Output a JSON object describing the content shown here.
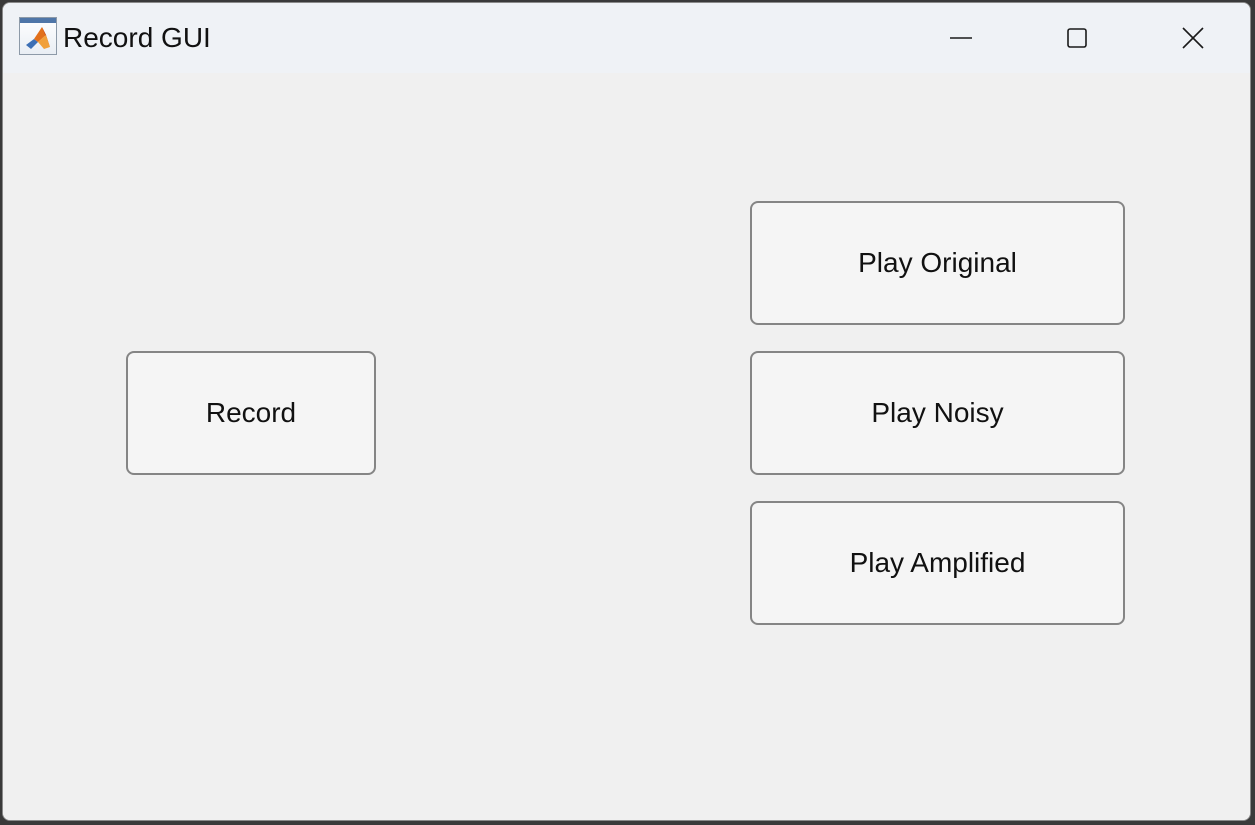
{
  "window": {
    "title": "Record GUI",
    "controls": {
      "minimize_icon": "minimize-icon",
      "maximize_icon": "maximize-icon",
      "close_icon": "close-icon"
    },
    "app_icon": "matlab-icon"
  },
  "buttons": {
    "record": "Record",
    "play_original": "Play Original",
    "play_noisy": "Play Noisy",
    "play_amplified": "Play Amplified"
  },
  "colors": {
    "titlebar": "#eff2f6",
    "background": "#f0f0f0",
    "button_fill": "#f5f5f5",
    "button_border": "#858585"
  }
}
